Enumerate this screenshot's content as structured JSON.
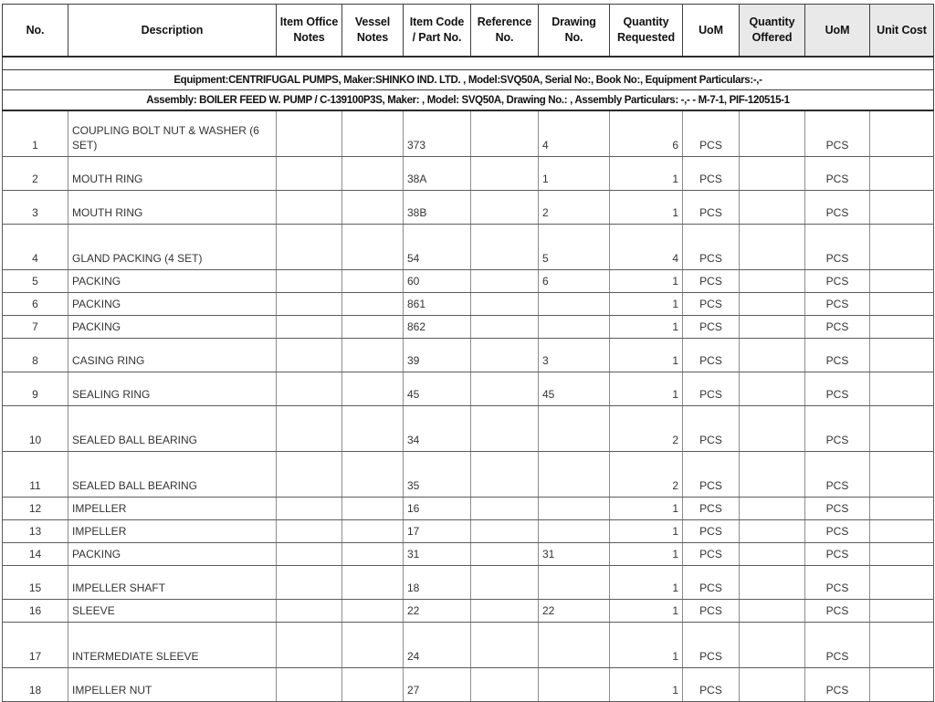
{
  "table": {
    "columns": [
      {
        "key": "no",
        "label": "No.",
        "shaded": false
      },
      {
        "key": "desc",
        "label": "Description",
        "shaded": false
      },
      {
        "key": "ionotes",
        "label": "Item Office\nNotes",
        "shaded": false
      },
      {
        "key": "vnotes",
        "label": "Vessel\nNotes",
        "shaded": false
      },
      {
        "key": "code",
        "label": "Item Code\n/ Part No.",
        "shaded": false
      },
      {
        "key": "ref",
        "label": "Reference\nNo.",
        "shaded": false
      },
      {
        "key": "draw",
        "label": "Drawing\nNo.",
        "shaded": false
      },
      {
        "key": "qreq",
        "label": "Quantity\nRequested",
        "shaded": false
      },
      {
        "key": "uom1",
        "label": "UoM",
        "shaded": false
      },
      {
        "key": "qoff",
        "label": "Quantity\nOffered",
        "shaded": true
      },
      {
        "key": "uom2",
        "label": "UoM",
        "shaded": true
      },
      {
        "key": "cost",
        "label": "Unit Cost",
        "shaded": true
      }
    ],
    "header_labels": {
      "no": "No.",
      "description": "Description",
      "item_office_notes_line1": "Item Office",
      "item_office_notes_line2": "Notes",
      "vessel_notes_line1": "Vessel",
      "vessel_notes_line2": "Notes",
      "item_code_line1": "Item Code",
      "item_code_line2": "/ Part No.",
      "reference_line1": "Reference",
      "reference_line2": "No.",
      "drawing_line1": "Drawing",
      "drawing_line2": "No.",
      "qty_requested_line1": "Quantity",
      "qty_requested_line2": "Requested",
      "uom_requested": "UoM",
      "qty_offered_line1": "Quantity",
      "qty_offered_line2": "Offered",
      "uom_offered": "UoM",
      "unit_cost": "Unit Cost"
    },
    "banners": {
      "equipment": "Equipment:CENTRIFUGAL PUMPS, Maker:SHINKO IND. LTD. , Model:SVQ50A, Serial No:, Book No:, Equipment Particulars:-,-",
      "assembly": "Assembly: BOILER FEED W. PUMP / C-139100P3S, Maker: , Model: SVQ50A, Drawing No.: , Assembly Particulars: -,- - M-7-1, PIF-120515-1"
    },
    "rows": [
      {
        "no": "1",
        "description": "COUPLING BOLT NUT & WASHER (6 SET)",
        "item_office_notes": "",
        "vessel_notes": "",
        "item_code": "373",
        "reference_no": "",
        "drawing_no": "4",
        "qty_requested": "6",
        "uom_requested": "PCS",
        "qty_offered": "",
        "uom_offered": "PCS",
        "unit_cost": "",
        "height": "h-tall"
      },
      {
        "no": "2",
        "description": "MOUTH RING",
        "item_office_notes": "",
        "vessel_notes": "",
        "item_code": "38A",
        "reference_no": "",
        "drawing_no": "1",
        "qty_requested": "1",
        "uom_requested": "PCS",
        "qty_offered": "",
        "uom_offered": "PCS",
        "unit_cost": "",
        "height": "h-mid"
      },
      {
        "no": "3",
        "description": "MOUTH RING",
        "item_office_notes": "",
        "vessel_notes": "",
        "item_code": "38B",
        "reference_no": "",
        "drawing_no": "2",
        "qty_requested": "1",
        "uom_requested": "PCS",
        "qty_offered": "",
        "uom_offered": "PCS",
        "unit_cost": "",
        "height": "h-mid"
      },
      {
        "no": "4",
        "description": "GLAND PACKING (4 SET)",
        "item_office_notes": "",
        "vessel_notes": "",
        "item_code": "54",
        "reference_no": "",
        "drawing_no": "5",
        "qty_requested": "4",
        "uom_requested": "PCS",
        "qty_offered": "",
        "uom_offered": "PCS",
        "unit_cost": "",
        "height": "h-tall"
      },
      {
        "no": "5",
        "description": "PACKING",
        "item_office_notes": "",
        "vessel_notes": "",
        "item_code": "60",
        "reference_no": "",
        "drawing_no": "6",
        "qty_requested": "1",
        "uom_requested": "PCS",
        "qty_offered": "",
        "uom_offered": "PCS",
        "unit_cost": "",
        "height": "h-short"
      },
      {
        "no": "6",
        "description": "PACKING",
        "item_office_notes": "",
        "vessel_notes": "",
        "item_code": "861",
        "reference_no": "",
        "drawing_no": "",
        "qty_requested": "1",
        "uom_requested": "PCS",
        "qty_offered": "",
        "uom_offered": "PCS",
        "unit_cost": "",
        "height": "h-short"
      },
      {
        "no": "7",
        "description": "PACKING",
        "item_office_notes": "",
        "vessel_notes": "",
        "item_code": "862",
        "reference_no": "",
        "drawing_no": "",
        "qty_requested": "1",
        "uom_requested": "PCS",
        "qty_offered": "",
        "uom_offered": "PCS",
        "unit_cost": "",
        "height": "h-short"
      },
      {
        "no": "8",
        "description": "CASING RING",
        "item_office_notes": "",
        "vessel_notes": "",
        "item_code": "39",
        "reference_no": "",
        "drawing_no": "3",
        "qty_requested": "1",
        "uom_requested": "PCS",
        "qty_offered": "",
        "uom_offered": "PCS",
        "unit_cost": "",
        "height": "h-mid"
      },
      {
        "no": "9",
        "description": "SEALING RING",
        "item_office_notes": "",
        "vessel_notes": "",
        "item_code": "45",
        "reference_no": "",
        "drawing_no": "45",
        "qty_requested": "1",
        "uom_requested": "PCS",
        "qty_offered": "",
        "uom_offered": "PCS",
        "unit_cost": "",
        "height": "h-mid"
      },
      {
        "no": "10",
        "description": "SEALED BALL BEARING",
        "item_office_notes": "",
        "vessel_notes": "",
        "item_code": "34",
        "reference_no": "",
        "drawing_no": "",
        "qty_requested": "2",
        "uom_requested": "PCS",
        "qty_offered": "",
        "uom_offered": "PCS",
        "unit_cost": "",
        "height": "h-tall"
      },
      {
        "no": "11",
        "description": "SEALED BALL BEARING",
        "item_office_notes": "",
        "vessel_notes": "",
        "item_code": "35",
        "reference_no": "",
        "drawing_no": "",
        "qty_requested": "2",
        "uom_requested": "PCS",
        "qty_offered": "",
        "uom_offered": "PCS",
        "unit_cost": "",
        "height": "h-tall"
      },
      {
        "no": "12",
        "description": "IMPELLER",
        "item_office_notes": "",
        "vessel_notes": "",
        "item_code": "16",
        "reference_no": "",
        "drawing_no": "",
        "qty_requested": "1",
        "uom_requested": "PCS",
        "qty_offered": "",
        "uom_offered": "PCS",
        "unit_cost": "",
        "height": "h-short"
      },
      {
        "no": "13",
        "description": "IMPELLER",
        "item_office_notes": "",
        "vessel_notes": "",
        "item_code": "17",
        "reference_no": "",
        "drawing_no": "",
        "qty_requested": "1",
        "uom_requested": "PCS",
        "qty_offered": "",
        "uom_offered": "PCS",
        "unit_cost": "",
        "height": "h-short"
      },
      {
        "no": "14",
        "description": "PACKING",
        "item_office_notes": "",
        "vessel_notes": "",
        "item_code": "31",
        "reference_no": "",
        "drawing_no": "31",
        "qty_requested": "1",
        "uom_requested": "PCS",
        "qty_offered": "",
        "uom_offered": "PCS",
        "unit_cost": "",
        "height": "h-short"
      },
      {
        "no": "15",
        "description": "IMPELLER SHAFT",
        "item_office_notes": "",
        "vessel_notes": "",
        "item_code": "18",
        "reference_no": "",
        "drawing_no": "",
        "qty_requested": "1",
        "uom_requested": "PCS",
        "qty_offered": "",
        "uom_offered": "PCS",
        "unit_cost": "",
        "height": "h-mid"
      },
      {
        "no": "16",
        "description": "SLEEVE",
        "item_office_notes": "",
        "vessel_notes": "",
        "item_code": "22",
        "reference_no": "",
        "drawing_no": "22",
        "qty_requested": "1",
        "uom_requested": "PCS",
        "qty_offered": "",
        "uom_offered": "PCS",
        "unit_cost": "",
        "height": "h-short"
      },
      {
        "no": "17",
        "description": "INTERMEDIATE SLEEVE",
        "item_office_notes": "",
        "vessel_notes": "",
        "item_code": "24",
        "reference_no": "",
        "drawing_no": "",
        "qty_requested": "1",
        "uom_requested": "PCS",
        "qty_offered": "",
        "uom_offered": "PCS",
        "unit_cost": "",
        "height": "h-tall"
      },
      {
        "no": "18",
        "description": "IMPELLER NUT",
        "item_office_notes": "",
        "vessel_notes": "",
        "item_code": "27",
        "reference_no": "",
        "drawing_no": "",
        "qty_requested": "1",
        "uom_requested": "PCS",
        "qty_offered": "",
        "uom_offered": "PCS",
        "unit_cost": "",
        "height": "h-mid"
      }
    ]
  },
  "colors": {
    "header_shade": "#e9e9e9",
    "border_dark": "#3f3f3f",
    "border_light": "#8d8d8d",
    "text": "#333333",
    "page_background": "#ffffff"
  }
}
